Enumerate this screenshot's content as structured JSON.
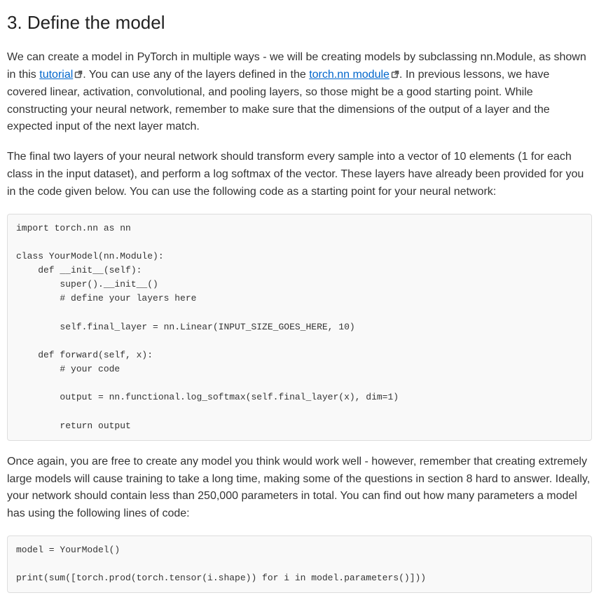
{
  "heading": "3. Define the model",
  "para1_part1": "We can create a model in PyTorch in multiple ways - we will be creating models by subclassing nn.Module, as shown in this ",
  "para1_link1": "tutorial",
  "para1_part2": ". You can use any of the layers defined in the ",
  "para1_link2": "torch.nn module",
  "para1_part3": ". In previous lessons, we have covered linear, activation, convolutional, and pooling layers, so those might be a good starting point. While constructing your neural network, remember to make sure that the dimensions of the output of a layer and the expected input of the next layer match.",
  "para2": "The final two layers of your neural network should transform every sample into a vector of 10 elements (1 for each class in the input dataset), and perform a log softmax of the vector. These layers have already been provided for you in the code given below. You can use the following code as a starting point for your neural network:",
  "code1": "import torch.nn as nn\n\nclass YourModel(nn.Module):\n    def __init__(self):\n        super().__init__()\n        # define your layers here\n\n        self.final_layer = nn.Linear(INPUT_SIZE_GOES_HERE, 10)\n\n    def forward(self, x):\n        # your code\n\n        output = nn.functional.log_softmax(self.final_layer(x), dim=1)\n\n        return output",
  "para3": "Once again, you are free to create any model you think would work well - however, remember that creating extremely large models will cause training to take a long time, making some of the questions in section 8 hard to answer. Ideally, your network should contain less than 250,000 parameters in total. You can find out how many parameters a model has using the following lines of code:",
  "code2": "model = YourModel()\n\nprint(sum([torch.prod(torch.tensor(i.shape)) for i in model.parameters()]))"
}
